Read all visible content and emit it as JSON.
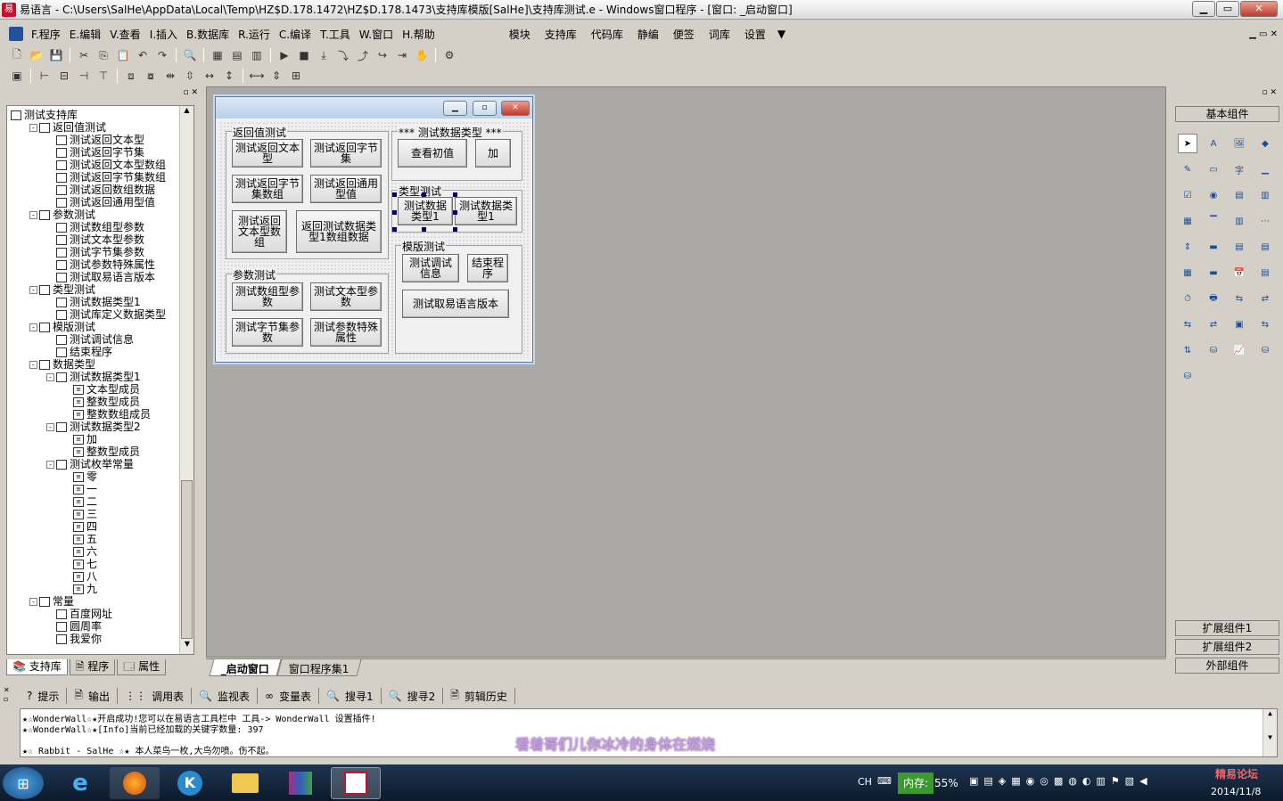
{
  "window": {
    "title": "易语言 - C:\\Users\\SalHe\\AppData\\Local\\Temp\\HZ$D.178.1472\\HZ$D.178.1473\\支持库模版[SalHe]\\支持库测试.e - Windows窗口程序 - [窗口: _启动窗口]"
  },
  "menu": {
    "items": [
      "F.程序",
      "E.编辑",
      "V.查看",
      "I.插入",
      "B.数据库",
      "R.运行",
      "C.编译",
      "T.工具",
      "W.窗口",
      "H.帮助"
    ],
    "right_items": [
      "模块",
      "支持库",
      "代码库",
      "静编",
      "便签",
      "词库",
      "设置"
    ]
  },
  "tree": {
    "lines": [
      {
        "text": "测试支持库",
        "level": 0,
        "ex": ""
      },
      {
        "text": "返回值测试",
        "level": 1,
        "ex": "-"
      },
      {
        "text": "测试返回文本型",
        "level": 2,
        "ex": ""
      },
      {
        "text": "测试返回字节集",
        "level": 2,
        "ex": ""
      },
      {
        "text": "测试返回文本型数组",
        "level": 2,
        "ex": ""
      },
      {
        "text": "测试返回字节集数组",
        "level": 2,
        "ex": ""
      },
      {
        "text": "测试返回数组数据",
        "level": 2,
        "ex": ""
      },
      {
        "text": "测试返回通用型值",
        "level": 2,
        "ex": ""
      },
      {
        "text": "参数测试",
        "level": 1,
        "ex": "-"
      },
      {
        "text": "测试数组型参数",
        "level": 2,
        "ex": ""
      },
      {
        "text": "测试文本型参数",
        "level": 2,
        "ex": ""
      },
      {
        "text": "测试字节集参数",
        "level": 2,
        "ex": ""
      },
      {
        "text": "测试参数特殊属性",
        "level": 2,
        "ex": ""
      },
      {
        "text": "测试取易语言版本",
        "level": 2,
        "ex": ""
      },
      {
        "text": "类型测试",
        "level": 1,
        "ex": "-"
      },
      {
        "text": "测试数据类型1",
        "level": 2,
        "ex": ""
      },
      {
        "text": "测试库定义数据类型",
        "level": 2,
        "ex": ""
      },
      {
        "text": "模版测试",
        "level": 1,
        "ex": "-"
      },
      {
        "text": "测试调试信息",
        "level": 2,
        "ex": ""
      },
      {
        "text": "结束程序",
        "level": 2,
        "ex": ""
      },
      {
        "text": "数据类型",
        "level": 1,
        "ex": "-"
      },
      {
        "text": "测试数据类型1",
        "level": 2,
        "ex": "-"
      },
      {
        "text": "文本型成员",
        "level": 3,
        "ex": ""
      },
      {
        "text": "整数型成员",
        "level": 3,
        "ex": ""
      },
      {
        "text": "整数数组成员",
        "level": 3,
        "ex": ""
      },
      {
        "text": "测试数据类型2",
        "level": 2,
        "ex": "-"
      },
      {
        "text": "加",
        "level": 3,
        "ex": ""
      },
      {
        "text": "整数型成员",
        "level": 3,
        "ex": ""
      },
      {
        "text": "测试枚举常量",
        "level": 2,
        "ex": "-"
      },
      {
        "text": "零",
        "level": 3,
        "ex": ""
      },
      {
        "text": "一",
        "level": 3,
        "ex": ""
      },
      {
        "text": "二",
        "level": 3,
        "ex": ""
      },
      {
        "text": "三",
        "level": 3,
        "ex": ""
      },
      {
        "text": "四",
        "level": 3,
        "ex": ""
      },
      {
        "text": "五",
        "level": 3,
        "ex": ""
      },
      {
        "text": "六",
        "level": 3,
        "ex": ""
      },
      {
        "text": "七",
        "level": 3,
        "ex": ""
      },
      {
        "text": "八",
        "level": 3,
        "ex": ""
      },
      {
        "text": "九",
        "level": 3,
        "ex": ""
      },
      {
        "text": "常量",
        "level": 1,
        "ex": "-"
      },
      {
        "text": "百度网址",
        "level": 2,
        "ex": ""
      },
      {
        "text": "圆周率",
        "level": 2,
        "ex": ""
      },
      {
        "text": "我爱你",
        "level": 2,
        "ex": ""
      }
    ],
    "tabs": [
      "支持库",
      "程序",
      "属性"
    ]
  },
  "editor_tabs": [
    "_启动窗口",
    "窗口程序集1"
  ],
  "form": {
    "groups": {
      "ret": "返回值测试",
      "param": "参数测试",
      "dtype": "*** 测试数据类型 ***",
      "typetest": "类型测试",
      "tmpl": "模版测试"
    },
    "buttons": {
      "b1": "测试返回文本型",
      "b2": "测试返回字节集",
      "b3": "测试返回字节集数组",
      "b4": "测试返回通用型值",
      "b5": "测试返回文本型数组",
      "b6": "返回测试数据类型1数组数据",
      "b7": "测试数组型参数",
      "b8": "测试文本型参数",
      "b9": "测试字节集参数",
      "b10": "测试参数特殊属性",
      "b11": "查看初值",
      "b12": "加",
      "b13": "测试数据类型1",
      "b14": "测试数据类型1",
      "b15": "测试调试信息",
      "b16": "结束程序",
      "b17": "测试取易语言版本"
    }
  },
  "components": {
    "header": "基本组件",
    "ext1": "扩展组件1",
    "ext2": "扩展组件2",
    "external": "外部组件"
  },
  "output": {
    "tabs": [
      "提示",
      "输出",
      "调用表",
      "监视表",
      "变量表",
      "搜寻1",
      "搜寻2",
      "剪辑历史"
    ],
    "lines": [
      "★☆WonderWall☆★开启成功!您可以在易语言工具栏中 工具-> WonderWall 设置插件!",
      "★☆WonderWall☆★[Info]当前已经加载的关键字数量: 397",
      "★☆ Rabbit - SalHe ☆★ 本人菜鸟一枚,大鸟勿喷。伤不起。"
    ],
    "overlay": "看着哥们儿你冰冷的身体在燃烧"
  },
  "taskbar": {
    "lang": "CH",
    "mem_label": "内存:",
    "mem_value": "55%",
    "date": "2014/11/8",
    "watermark": "精易论坛"
  },
  "colors": {
    "accent": "#c8102e",
    "designer_bg": "#aba9a5",
    "form_bg": "#f0f0f0"
  }
}
